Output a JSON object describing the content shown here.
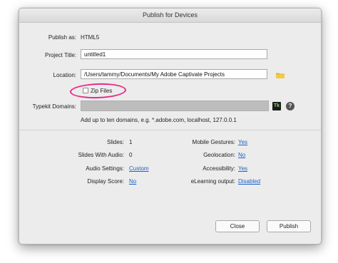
{
  "dialog": {
    "title": "Publish for Devices"
  },
  "form": {
    "publish_as_label": "Publish as:",
    "publish_as_value": "HTML5",
    "project_title_label": "Project Title:",
    "project_title_value": "untitled1",
    "location_label": "Location:",
    "location_value": "/Users/tammy/Documents/My Adobe Captivate Projects",
    "zip_files_label": "Zip Files",
    "zip_files_checked": false,
    "typekit_label": "Typekit Domains:",
    "typekit_value": "",
    "typekit_hint": "Add up to ten domains, e.g. *.adobe.com, localhost, 127.0.0.1",
    "typekit_icon_text": "Tk",
    "help_icon_text": "?"
  },
  "summary": {
    "slides_label": "Slides:",
    "slides_value": "1",
    "slides_with_audio_label": "Slides With Audio:",
    "slides_with_audio_value": "0",
    "audio_settings_label": "Audio Settings:",
    "audio_settings_value": "Custom",
    "display_score_label": "Display Score:",
    "display_score_value": "No",
    "mobile_gestures_label": "Mobile Gestures:",
    "mobile_gestures_value": "Yes",
    "geolocation_label": "Geolocation:",
    "geolocation_value": "No",
    "accessibility_label": "Accessibility:",
    "accessibility_value": "Yes",
    "elearning_output_label": "eLearning output:",
    "elearning_output_value": "Disabled"
  },
  "buttons": {
    "close_label": "Close",
    "publish_label": "Publish"
  },
  "colors": {
    "link": "#1a62c7",
    "annotation": "#e82a86",
    "folder": "#e6b32e"
  }
}
